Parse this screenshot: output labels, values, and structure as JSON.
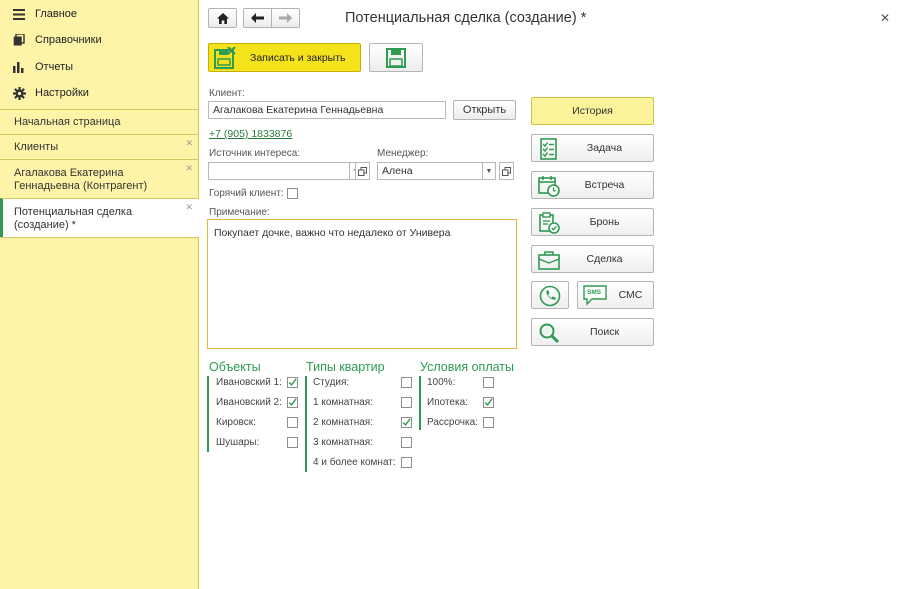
{
  "sidebar": {
    "nav": [
      {
        "label": "Главное",
        "icon": "menu-icon"
      },
      {
        "label": "Справочники",
        "icon": "catalog-icon"
      },
      {
        "label": "Отчеты",
        "icon": "bar-chart-icon"
      },
      {
        "label": "Настройки",
        "icon": "gear-icon"
      }
    ],
    "open_tabs": [
      {
        "label": "Начальная страница",
        "closable": false
      },
      {
        "label": "Клиенты",
        "closable": true
      },
      {
        "label": "Агалакова Екатерина Геннадьевна (Контрагент)",
        "closable": true
      },
      {
        "label": "Потенциальная сделка (создание) *",
        "closable": true
      }
    ]
  },
  "header": {
    "title": "Потенциальная сделка (создание) *"
  },
  "toolbar": {
    "save_close_label": "Записать и закрыть"
  },
  "form": {
    "client_label": "Клиент:",
    "client_value": "Агалакова Екатерина Геннадьевна",
    "open_label": "Открыть",
    "phone": "+7 (905) 1833876",
    "source_label": "Источник интереса:",
    "source_value": "",
    "manager_label": "Менеджер:",
    "manager_value": "Алена",
    "hot_label": "Горячий клиент:",
    "note_label": "Примечание:",
    "note_value": "Покупает дочке, важно что недалеко от Универа"
  },
  "groups": {
    "objects": {
      "title": "Объекты",
      "items": [
        {
          "label": "Ивановский 1:",
          "checked": true
        },
        {
          "label": "Ивановский 2:",
          "checked": true
        },
        {
          "label": "Кировск:",
          "checked": false
        },
        {
          "label": "Шушары:",
          "checked": false
        }
      ]
    },
    "apartments": {
      "title": "Типы квартир",
      "items": [
        {
          "label": "Студия:",
          "checked": false
        },
        {
          "label": "1 комнатная:",
          "checked": false
        },
        {
          "label": "2 комнатная:",
          "checked": true
        },
        {
          "label": "3 комнатная:",
          "checked": false
        },
        {
          "label": "4 и более комнат:",
          "checked": false
        }
      ]
    },
    "payment": {
      "title": "Условия оплаты",
      "items": [
        {
          "label": "100%:",
          "checked": false
        },
        {
          "label": "Ипотека:",
          "checked": true
        },
        {
          "label": "Рассрочка:",
          "checked": false
        }
      ]
    }
  },
  "actions": {
    "history": "История",
    "task": "Задача",
    "meeting": "Встреча",
    "booking": "Бронь",
    "deal": "Сделка",
    "sms_badge": "SMS",
    "sms": "СМС",
    "search": "Поиск"
  },
  "colors": {
    "sidebar_bg": "#fdf4a8",
    "accent_green": "#2e9a52",
    "primary_button": "#f4e21a",
    "history_button": "#fbf39a"
  }
}
